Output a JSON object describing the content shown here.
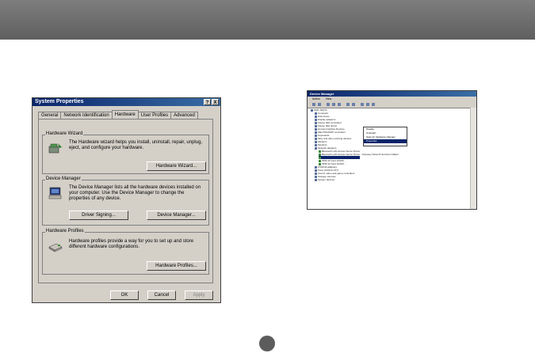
{
  "system_properties": {
    "title": "System Properties",
    "title_buttons": [
      "?",
      "X"
    ],
    "tabs": [
      "General",
      "Network Identification",
      "Hardware",
      "User Profiles",
      "Advanced"
    ],
    "active_tab": "Hardware",
    "hardware_wizard": {
      "heading": "Hardware Wizard",
      "text": "The Hardware wizard helps you install, uninstall, repair, unplug, eject, and configure your hardware.",
      "button": "Hardware Wizard..."
    },
    "device_manager": {
      "heading": "Device Manager",
      "text": "The Device Manager lists all the hardware devices installed on your computer. Use the Device Manager to change the properties of any device.",
      "button_signing": "Driver Signing...",
      "button_dm": "Device Manager..."
    },
    "hardware_profiles": {
      "heading": "Hardware Profiles",
      "text": "Hardware profiles provide a way for you to set up and store different hardware configurations.",
      "button": "Hardware Profiles..."
    },
    "footer": {
      "ok": "OK",
      "cancel": "Cancel",
      "apply": "Apply"
    }
  },
  "device_manager_window": {
    "title": "Device Manager",
    "menu": [
      "Action",
      "View"
    ],
    "tree": [
      "W2K-TEST1",
      "Computer",
      "Disk drives",
      "Display adapters",
      "Floppy disk controllers",
      "Floppy disk drives",
      "Human Interface Devices",
      "IDE ATA/ATAPI controllers",
      "Keyboards",
      "Mice and other pointing devices",
      "Modems",
      "Monitors",
      "Network adapters",
      "Bluetooth LAN Access Server Driver",
      "Bluetooth LAN Access Server Driver - Odyssey Network Services Ndisprt",
      "",
      "3PM-32 Card 10/100 ...",
      "3PM-32 Card 10/100 ...",
      "PCMCIA adapters",
      "Ports (COM & LPT)",
      "Sound, video and game controllers",
      "Storage volumes",
      "System devices"
    ],
    "context_menu": [
      "Disable",
      "Uninstall...",
      "Scan for hardware changes",
      "Properties"
    ],
    "context_selected": "Properties"
  }
}
